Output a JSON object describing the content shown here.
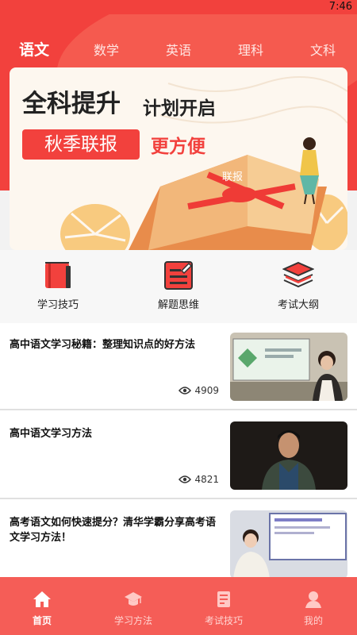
{
  "status_bar": {
    "time": "7:46"
  },
  "tabs": [
    {
      "label": "语文",
      "active": true
    },
    {
      "label": "数学",
      "active": false
    },
    {
      "label": "英语",
      "active": false
    },
    {
      "label": "理科",
      "active": false
    },
    {
      "label": "文科",
      "active": false
    }
  ],
  "banner": {
    "title_main": "全科提升",
    "title_sub": "计划开启",
    "badge": "秋季联报",
    "subtitle": "更方便",
    "book_text": "联报"
  },
  "quick_links": [
    {
      "label": "学习技巧",
      "icon": "book-icon"
    },
    {
      "label": "解题思维",
      "icon": "edit-note-icon"
    },
    {
      "label": "考试大纲",
      "icon": "layers-icon"
    }
  ],
  "articles": [
    {
      "title": "高中语文学习秘籍：整理知识点的好方法",
      "views": "4909",
      "thumb": "teacher-classroom-thumbnail"
    },
    {
      "title": "高中语文学习方法",
      "views": "4821",
      "thumb": "student-portrait-thumbnail"
    },
    {
      "title": "高考语文如何快速提分？清华学霸分享高考语文学习方法！",
      "views": "",
      "thumb": "lecture-screen-thumbnail"
    }
  ],
  "bottom_nav": [
    {
      "label": "首页",
      "icon": "home-icon",
      "active": true
    },
    {
      "label": "学习方法",
      "icon": "graduation-cap-icon",
      "active": false
    },
    {
      "label": "考试技巧",
      "icon": "document-icon",
      "active": false
    },
    {
      "label": "我的",
      "icon": "user-icon",
      "active": false
    }
  ],
  "colors": {
    "primary": "#f2413d",
    "nav_bg": "#f55d57",
    "highlight": "#f2413d"
  }
}
